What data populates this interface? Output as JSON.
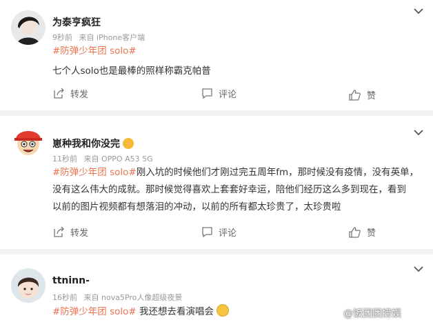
{
  "comments": [
    {
      "username": "为泰亨疯狂",
      "time": "9秒前",
      "source": "来自 iPhone客户端",
      "text_lines": [
        {
          "tag": "#防弹少年团 solo#",
          "text": ""
        },
        {
          "tag": "",
          "text": "七个人solo也是最棒的照样称霸克帕普"
        }
      ],
      "actions": {
        "repost": "转发",
        "comment": "评论",
        "like": "赞"
      }
    },
    {
      "username": "崽种我和你没完",
      "time": "11秒前",
      "source": "来自 OPPO A53 5G",
      "text_lines": [
        {
          "tag": "#防弹少年团 solo#",
          "text": "刚入坑的时候他们才刚过完五周年fm，那时候没有疫情，没有英单，"
        },
        {
          "tag": "",
          "text": "没有这么伟大的成就。那时候觉得喜欢上套套好幸运，陪他们经历这么多到现在，看到"
        },
        {
          "tag": "",
          "text": "以前的图片视频都有想落泪的冲动，以前的所有都太珍贵了，太珍贵啦"
        }
      ],
      "actions": {
        "repost": "转发",
        "comment": "评论",
        "like": "赞"
      }
    },
    {
      "username": "ttninn-",
      "time": "16秒前",
      "source": "来自 nova5Pro人像超级夜景",
      "text_lines": [
        {
          "tag": "#防弹少年团 solo#",
          "text": " 我还想去看演唱会"
        }
      ]
    }
  ],
  "watermark": "@饭团团捞娱",
  "colors": {
    "tag": "#eb7350",
    "background": "#f2f2f2",
    "card": "#ffffff"
  },
  "icons": [
    "chevron-down-icon",
    "repost-icon",
    "comment-icon",
    "like-icon",
    "crying-emoji-icon"
  ]
}
